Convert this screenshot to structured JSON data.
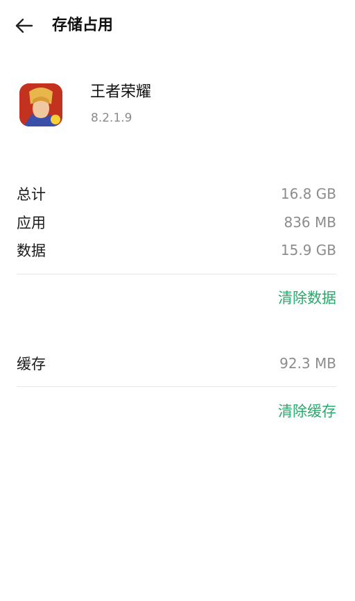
{
  "header": {
    "title": "存储占用",
    "back_icon": "arrow-left-icon"
  },
  "app": {
    "name": "王者荣耀",
    "version": "8.2.1.9",
    "icon": "game-app-icon"
  },
  "storage": {
    "rows": [
      {
        "label": "总计",
        "value": "16.8 GB"
      },
      {
        "label": "应用",
        "value": "836 MB"
      },
      {
        "label": "数据",
        "value": "15.9 GB"
      }
    ],
    "clear_data_label": "清除数据"
  },
  "cache": {
    "label": "缓存",
    "value": "92.3 MB",
    "clear_cache_label": "清除缓存"
  },
  "colors": {
    "accent": "#2aa86e",
    "secondary_text": "#8c8c8c",
    "divider": "#e6e6e6"
  }
}
